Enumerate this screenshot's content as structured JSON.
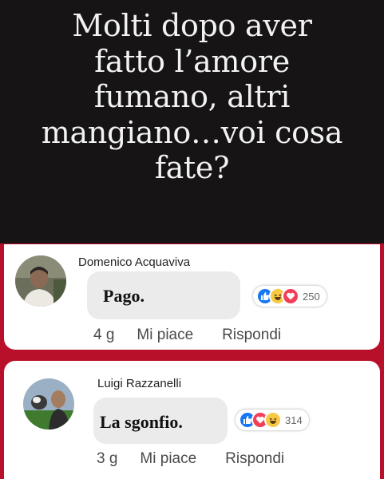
{
  "header": {
    "lines": [
      "Molti dopo aver",
      "fatto l’amore",
      "fumano, altri",
      "mangiano…voi cosa",
      "fate?"
    ]
  },
  "comments": [
    {
      "author": "Domenico Acquaviva",
      "text": "Pago.",
      "reactions": [
        "like-icon",
        "haha-icon",
        "love-icon"
      ],
      "reaction_count": "250",
      "age": "4 g",
      "like_label": "Mi piace",
      "reply_label": "Rispondi"
    },
    {
      "author": "Luigi Razzanelli",
      "text": "La sgonfio.",
      "reactions": [
        "like-icon",
        "love-icon",
        "haha-icon"
      ],
      "reaction_count": "314",
      "age": "3 g",
      "like_label": "Mi piace",
      "reply_label": "Rispondi"
    }
  ],
  "colors": {
    "header_bg": "#161414",
    "frame_red": "#b8102a",
    "like_blue": "#1877f2",
    "love_red": "#f33e58",
    "haha_yellow": "#f7c945"
  }
}
